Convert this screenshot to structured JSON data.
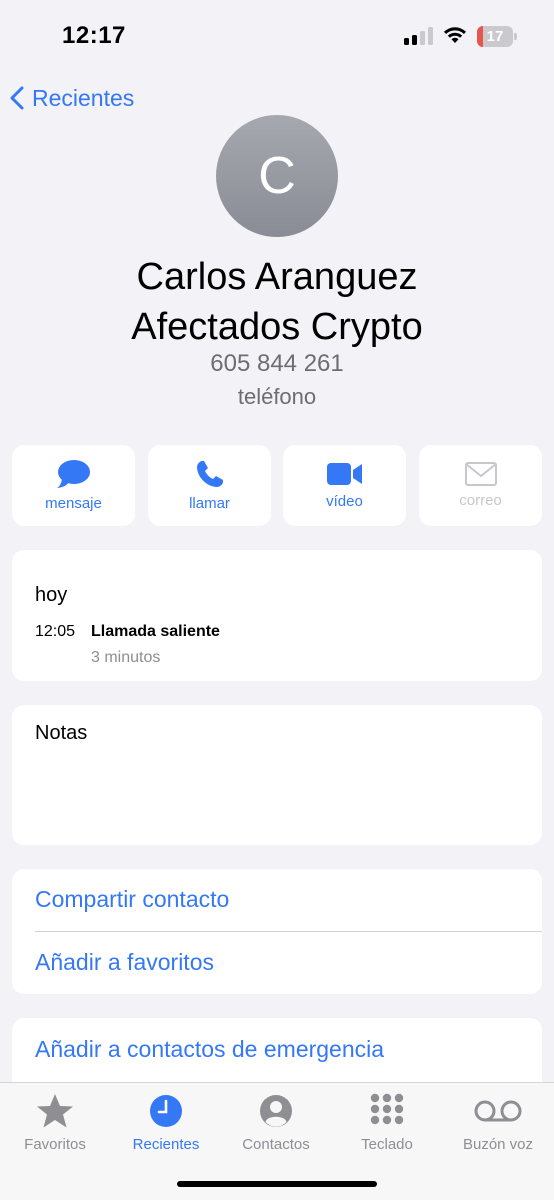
{
  "status_bar": {
    "time": "12:17",
    "battery_level": "17",
    "battery_fraction": 0.17,
    "signal_bars_active": 2,
    "signal_bars_total": 4,
    "icons": [
      "signal-icon",
      "wifi-icon",
      "battery-icon"
    ]
  },
  "nav": {
    "back_label": "Recientes"
  },
  "contact": {
    "avatar_initial": "C",
    "name_line1": "Carlos Aranguez",
    "name_line2": "Afectados Crypto",
    "phone_number": "605 844 261",
    "phone_type": "teléfono"
  },
  "actions": [
    {
      "label": "mensaje",
      "icon": "message-icon",
      "enabled": true
    },
    {
      "label": "llamar",
      "icon": "phone-icon",
      "enabled": true
    },
    {
      "label": "vídeo",
      "icon": "video-icon",
      "enabled": true
    },
    {
      "label": "correo",
      "icon": "mail-icon",
      "enabled": false
    }
  ],
  "call_history": {
    "day": "hoy",
    "entries": [
      {
        "time": "12:05",
        "type": "Llamada saliente",
        "duration": "3 minutos"
      }
    ]
  },
  "notes": {
    "label": "Notas",
    "value": ""
  },
  "links": {
    "share_contact": "Compartir contacto",
    "add_favorites": "Añadir a favoritos",
    "add_emergency": "Añadir a contactos de emergencia"
  },
  "tab_bar": {
    "tabs": [
      {
        "label": "Favoritos",
        "icon": "star-icon",
        "active": false
      },
      {
        "label": "Recientes",
        "icon": "clock-icon",
        "active": true
      },
      {
        "label": "Contactos",
        "icon": "person-icon",
        "active": false
      },
      {
        "label": "Teclado",
        "icon": "keypad-icon",
        "active": false
      },
      {
        "label": "Buzón voz",
        "icon": "voicemail-icon",
        "active": false
      }
    ]
  },
  "colors": {
    "accent": "#3478f6",
    "background": "#f2f2f7",
    "card": "#ffffff",
    "secondary_text": "#8e8e93",
    "battery_low": "#e8554d",
    "disabled": "#c7c7cc"
  }
}
